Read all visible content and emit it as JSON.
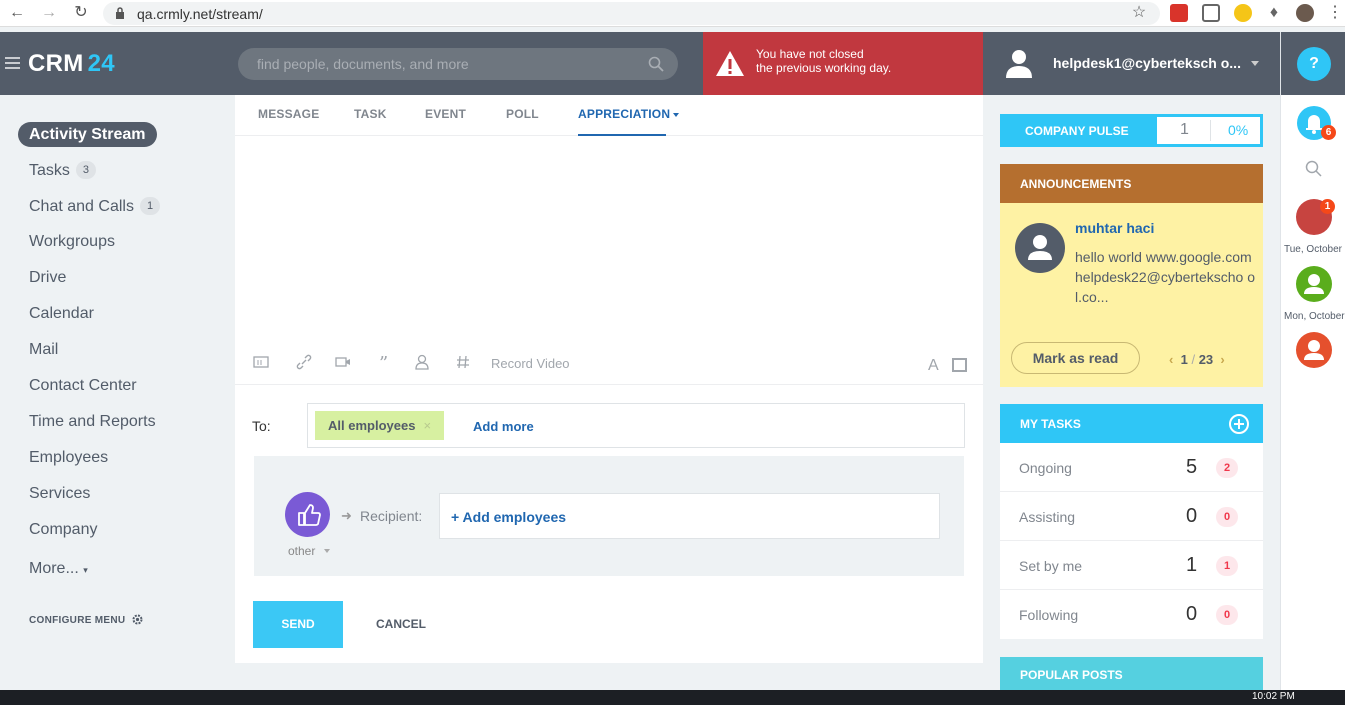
{
  "browser": {
    "url": "qa.crmly.net/stream/"
  },
  "header": {
    "logo_text": "CRM",
    "logo_num": "24",
    "search_placeholder": "find people, documents, and more",
    "alert_line1": "You have not closed",
    "alert_line2": "the previous working day.",
    "user_name": "helpdesk1@cyberteksch o...",
    "help_label": "?"
  },
  "sidebar": {
    "active": "Activity Stream",
    "items": [
      {
        "label": "Tasks",
        "count": "3"
      },
      {
        "label": "Chat and Calls",
        "count": "1"
      },
      {
        "label": "Workgroups"
      },
      {
        "label": "Drive"
      },
      {
        "label": "Calendar"
      },
      {
        "label": "Mail"
      },
      {
        "label": "Contact Center"
      },
      {
        "label": "Time and Reports"
      },
      {
        "label": "Employees"
      },
      {
        "label": "Services"
      },
      {
        "label": "Company"
      },
      {
        "label": "More..."
      }
    ],
    "configure": "CONFIGURE MENU"
  },
  "composer": {
    "tabs": [
      "MESSAGE",
      "TASK",
      "EVENT",
      "POLL",
      "APPRECIATION"
    ],
    "active_tab": "APPRECIATION",
    "record_video": "Record Video",
    "font_icon": "A",
    "to_label": "To:",
    "chip": "All employees",
    "chip_x": "×",
    "add_more": "Add more",
    "other": "other",
    "recipient_label": "Recipient:",
    "add_employees": "+ Add employees",
    "send": "SEND",
    "cancel": "CANCEL"
  },
  "right_panel": {
    "bell_count": "6",
    "chat_count": "1",
    "date1": "Tue, October",
    "date2": "Mon, October"
  },
  "widgets": {
    "pulse_label": "COMPANY PULSE",
    "pulse_value": "1",
    "pulse_pct": "0%",
    "announcements_title": "ANNOUNCEMENTS",
    "ann_author": "muhtar haci",
    "ann_text": "hello world www.google.com helpdesk22@cybertekscho ol.co...",
    "mark_read": "Mark as read",
    "page_current": "1",
    "page_sep": "/",
    "page_total": "23",
    "tasks_title": "MY TASKS",
    "tasks": [
      {
        "label": "Ongoing",
        "num": "5",
        "badge": "2"
      },
      {
        "label": "Assisting",
        "num": "0",
        "badge": "0"
      },
      {
        "label": "Set by me",
        "num": "1",
        "badge": "1"
      },
      {
        "label": "Following",
        "num": "0",
        "badge": "0"
      }
    ],
    "popular_title": "POPULAR POSTS"
  },
  "taskbar": {
    "clock": "10:02 PM"
  },
  "colors": {
    "header": "#535c69",
    "accent": "#2fc6f6",
    "alert": "#c1383f",
    "link": "#2067b0",
    "announcement_bg": "#fef2a4"
  }
}
